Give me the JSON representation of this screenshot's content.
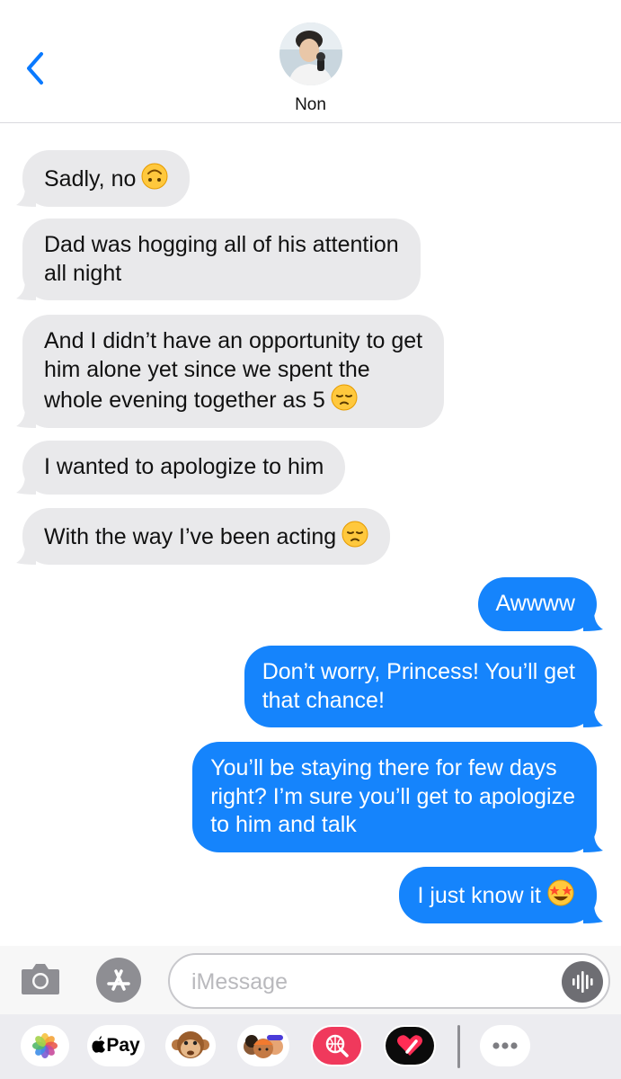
{
  "header": {
    "contact_name": "Non",
    "back_icon": "chevron-left-icon",
    "avatar_icon": "contact-avatar"
  },
  "messages": [
    {
      "direction": "incoming",
      "text": "Sadly, no",
      "emoji": "upside-down-face"
    },
    {
      "direction": "incoming",
      "lines": [
        "Dad was hogging all of his attention",
        "all night"
      ]
    },
    {
      "direction": "incoming",
      "lines": [
        "And I didn’t have an opportunity to get",
        "him alone yet since we spent the",
        "whole evening together as 5"
      ],
      "emoji": "pensive-face"
    },
    {
      "direction": "incoming",
      "text": "I wanted to apologize to him"
    },
    {
      "direction": "incoming",
      "text": "With the way I’ve been acting",
      "emoji": "pensive-face"
    },
    {
      "direction": "outgoing",
      "text": "Awwww"
    },
    {
      "direction": "outgoing",
      "lines": [
        "Don’t worry, Princess! You’ll get",
        "that chance!"
      ]
    },
    {
      "direction": "outgoing",
      "lines": [
        "You’ll be staying there for few days",
        "right? I’m sure you’ll get to apologize",
        "to him and talk"
      ]
    },
    {
      "direction": "outgoing",
      "text": "I just know it",
      "emoji": "star-struck"
    }
  ],
  "input": {
    "placeholder": "iMessage",
    "value": ""
  },
  "drawer": {
    "apple_pay_label": "Pay",
    "apps": [
      "photos-icon",
      "apple-pay-icon",
      "monkey-animoji-icon",
      "memoji-icon",
      "web-search-icon",
      "digital-touch-icon",
      "more-icon"
    ]
  },
  "colors": {
    "incoming_bubble": "#e9e9eb",
    "outgoing_bubble": "#1584fc",
    "accent": "#0a7aff"
  }
}
